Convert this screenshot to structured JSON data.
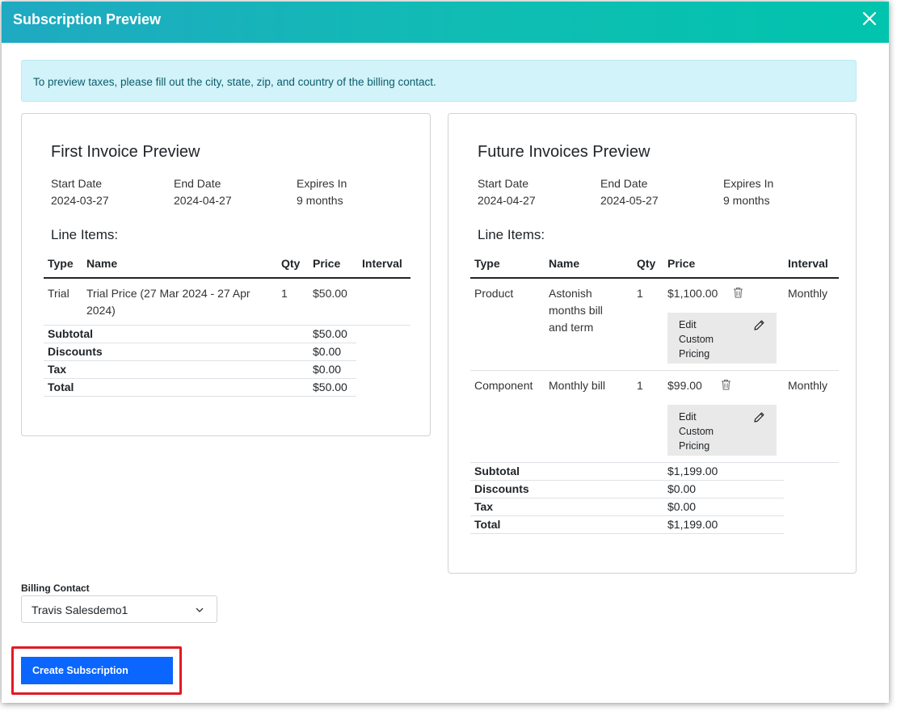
{
  "modal": {
    "title": "Subscription Preview"
  },
  "alert": {
    "text": "To preview taxes, please fill out the city, state, zip, and country of the billing contact."
  },
  "first_invoice": {
    "title": "First Invoice Preview",
    "start_label": "Start Date",
    "start_value": "2024-03-27",
    "end_label": "End Date",
    "end_value": "2024-04-27",
    "expires_label": "Expires In",
    "expires_value": "9 months",
    "line_items_title": "Line Items:",
    "columns": [
      "Type",
      "Name",
      "Qty",
      "Price",
      "Interval"
    ],
    "rows": [
      {
        "type": "Trial",
        "name_line1": "Trial Price (27 Mar 2024 - 27 Apr",
        "name_line2": "2024)",
        "qty": "1",
        "price": "$50.00",
        "interval": ""
      }
    ],
    "summary": [
      {
        "label": "Subtotal",
        "value": "$50.00"
      },
      {
        "label": "Discounts",
        "value": "$0.00"
      },
      {
        "label": "Tax",
        "value": "$0.00"
      },
      {
        "label": "Total",
        "value": "$50.00"
      }
    ]
  },
  "future_invoices": {
    "title": "Future Invoices Preview",
    "start_label": "Start Date",
    "start_value": "2024-04-27",
    "end_label": "End Date",
    "end_value": "2024-05-27",
    "expires_label": "Expires In",
    "expires_value": "9 months",
    "line_items_title": "Line Items:",
    "columns": [
      "Type",
      "Name",
      "Qty",
      "Price",
      "Interval"
    ],
    "rows": [
      {
        "type": "Product",
        "name_line1": "Astonish",
        "name_line2": "months bill",
        "name_line3": "and term",
        "qty": "1",
        "price": "$1,100.00",
        "interval": "Monthly",
        "edit_line1": "Edit",
        "edit_line2": "Custom",
        "edit_line3": "Pricing"
      },
      {
        "type": "Component",
        "name_line1": "Monthly bill",
        "qty": "1",
        "price": "$99.00",
        "interval": "Monthly",
        "edit_line1": "Edit",
        "edit_line2": "Custom",
        "edit_line3": "Pricing"
      }
    ],
    "summary": [
      {
        "label": "Subtotal",
        "value": "$1,199.00"
      },
      {
        "label": "Discounts",
        "value": "$0.00"
      },
      {
        "label": "Tax",
        "value": "$0.00"
      },
      {
        "label": "Total",
        "value": "$1,199.00"
      }
    ]
  },
  "billing_contact": {
    "label": "Billing Contact",
    "selected": "Travis Salesdemo1"
  },
  "actions": {
    "create_label": "Create Subscription"
  },
  "colors": {
    "header_start": "#1fa9c2",
    "header_end": "#00c4ad",
    "alert_bg": "#d1f3f9",
    "primary_button": "#0a66ff",
    "highlight_border": "#e01b24"
  },
  "icons": {
    "close": "close-icon",
    "trash": "trash-icon",
    "pencil": "pencil-icon",
    "chevron": "chevron-down-icon"
  }
}
